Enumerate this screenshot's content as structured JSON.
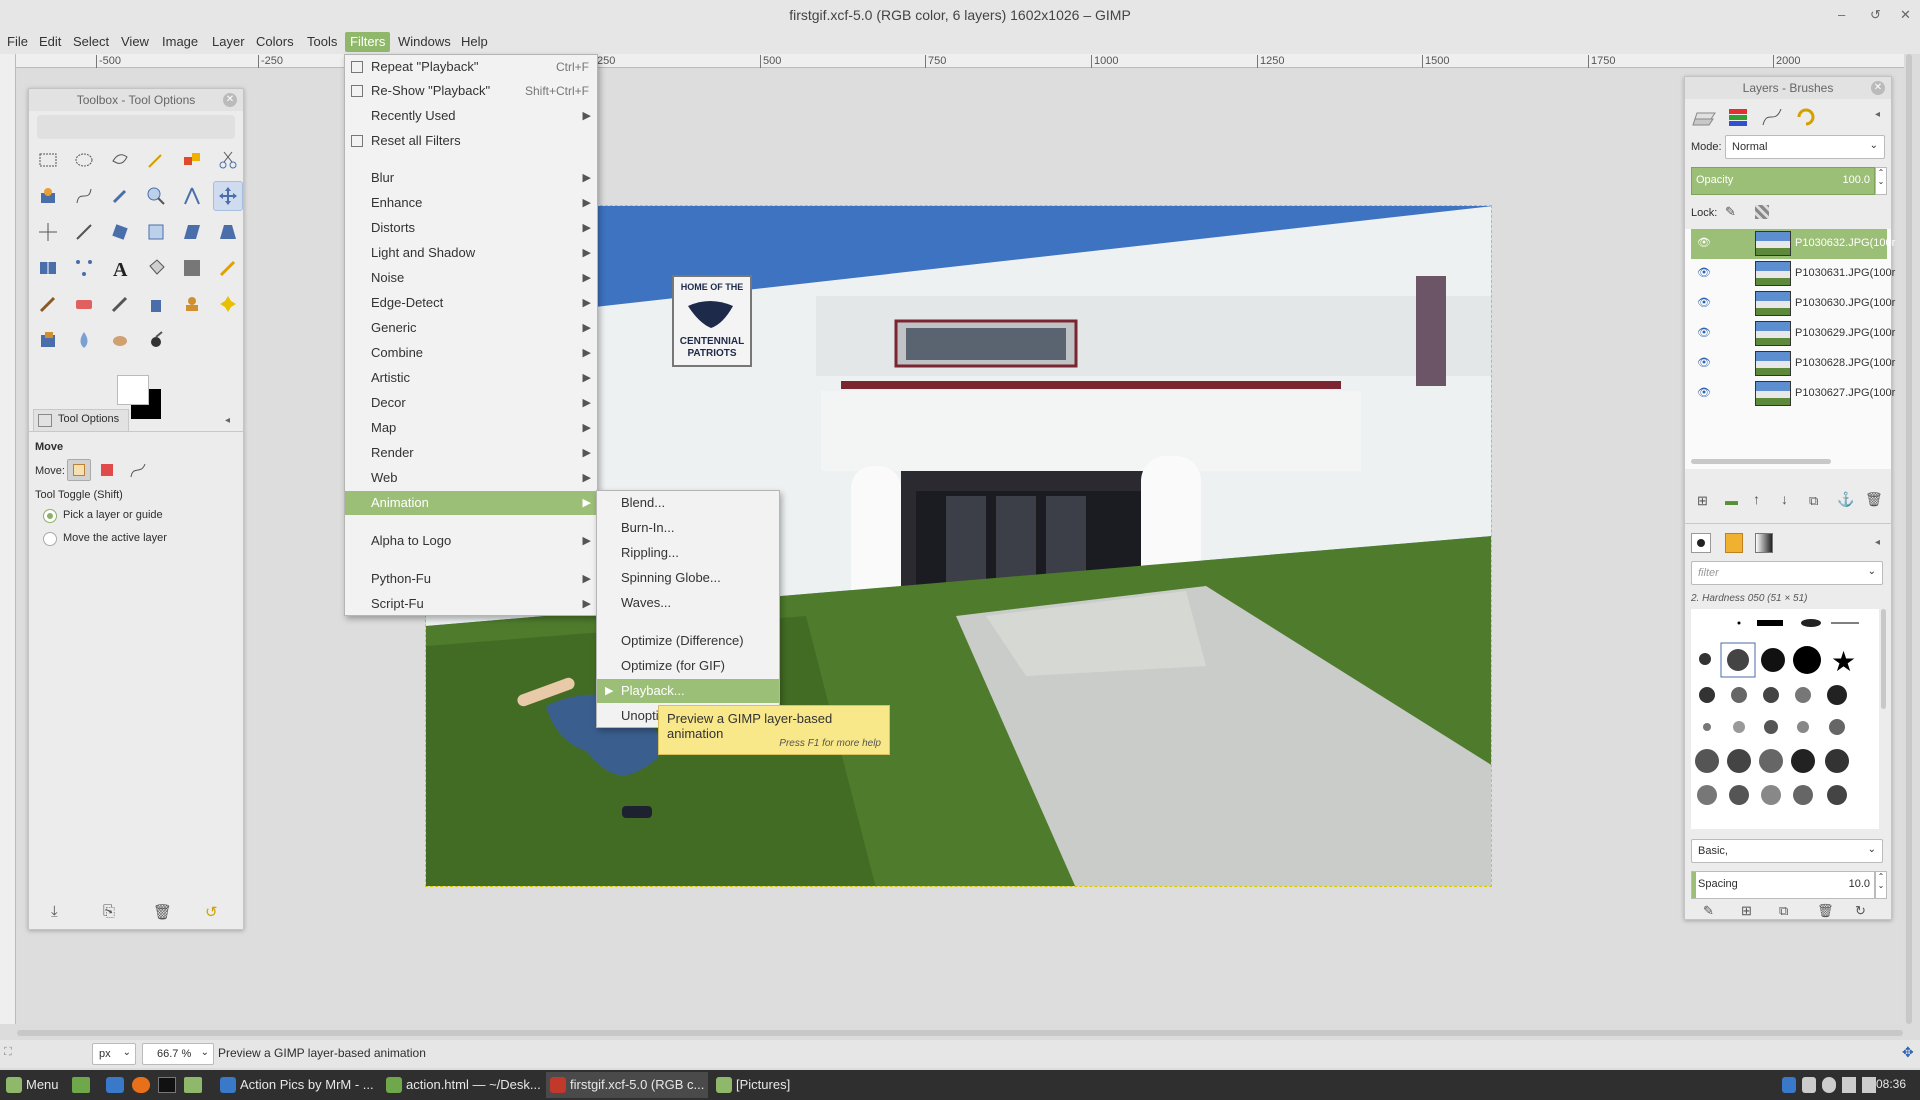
{
  "window": {
    "title": "firstgif.xcf-5.0 (RGB color, 6 layers) 1602x1026 – GIMP",
    "controls": [
      "–",
      "↺",
      "✕"
    ]
  },
  "menubar": [
    "File",
    "Edit",
    "Select",
    "View",
    "Image",
    "Layer",
    "Colors",
    "Tools",
    "Filters",
    "Windows",
    "Help"
  ],
  "ruler": {
    "ticks": [
      "-500",
      "-250",
      "250",
      "500",
      "750",
      "1000",
      "1250",
      "1500",
      "1750",
      "2000"
    ]
  },
  "filters_menu": {
    "repeat": {
      "label": "Repeat \"Playback\"",
      "shortcut": "Ctrl+F"
    },
    "reshow": {
      "label": "Re-Show \"Playback\"",
      "shortcut": "Shift+Ctrl+F"
    },
    "recently_used": "Recently Used",
    "reset": "Reset all Filters",
    "categories": [
      "Blur",
      "Enhance",
      "Distorts",
      "Light and Shadow",
      "Noise",
      "Edge-Detect",
      "Generic",
      "Combine",
      "Artistic",
      "Decor",
      "Map",
      "Render",
      "Web",
      "Animation"
    ],
    "alpha_to_logo": "Alpha to Logo",
    "python_fu": "Python-Fu",
    "script_fu": "Script-Fu"
  },
  "animation_submenu": {
    "items": [
      "Blend...",
      "Burn-In...",
      "Rippling...",
      "Spinning Globe...",
      "Waves..."
    ],
    "items2": [
      "Optimize (Difference)",
      "Optimize (for GIF)",
      "Playback...",
      "Unopti"
    ]
  },
  "tooltip": {
    "text": "Preview a GIMP layer-based animation",
    "help": "Press F1 for more help"
  },
  "toolbox": {
    "title": "Toolbox - Tool Options",
    "tab": "Tool Options",
    "tool_name": "Move",
    "move_label": "Move:",
    "toggle_label": "Tool Toggle  (Shift)",
    "options": [
      "Pick a layer or guide",
      "Move the active layer"
    ]
  },
  "image": {
    "sign_line1": "HOME OF THE",
    "sign_line2": "CENTENNIAL",
    "sign_line3": "PATRIOTS"
  },
  "layers_panel": {
    "title": "Layers - Brushes",
    "mode_label": "Mode:",
    "mode_value": "Normal",
    "opacity_label": "Opacity",
    "opacity_value": "100.0",
    "lock_label": "Lock:",
    "layers": [
      "P1030632.JPG(100r",
      "P1030631.JPG(100r",
      "P1030630.JPG(100r",
      "P1030629.JPG(100r",
      "P1030628.JPG(100r",
      "P1030627.JPG(100r"
    ]
  },
  "brushes_panel": {
    "filter_placeholder": "filter",
    "brush_name": "2. Hardness 050 (51 × 51)",
    "preset": "Basic,",
    "spacing_label": "Spacing",
    "spacing_value": "10.0"
  },
  "statusbar": {
    "unit": "px",
    "zoom": "66.7 %",
    "message": "Preview a GIMP layer-based animation"
  },
  "taskbar": {
    "menu": "Menu",
    "windows": [
      "Action Pics by MrM - ...",
      "action.html — ~/Desk...",
      "firstgif.xcf-5.0 (RGB c...",
      "[Pictures]"
    ],
    "clock": "08:36"
  },
  "colors": {
    "accent": "#9cbf77",
    "tooltip": "#f8e88a"
  }
}
